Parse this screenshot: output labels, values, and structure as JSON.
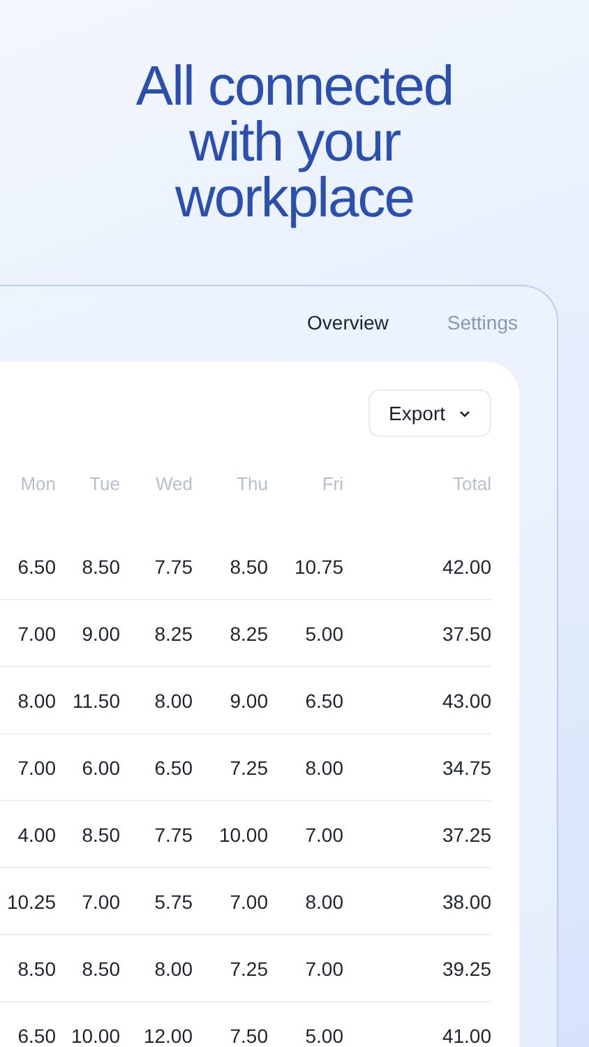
{
  "headline": "All connected with your workplace",
  "tabs": [
    {
      "label": "Overview",
      "selected": true
    },
    {
      "label": "Settings",
      "selected": false
    }
  ],
  "export_button": {
    "label": "Export"
  },
  "table": {
    "columns": [
      "Mon",
      "Tue",
      "Wed",
      "Thu",
      "Fri",
      "Total"
    ],
    "rows": [
      [
        "6.50",
        "8.50",
        "7.75",
        "8.50",
        "10.75",
        "42.00"
      ],
      [
        "7.00",
        "9.00",
        "8.25",
        "8.25",
        "5.00",
        "37.50"
      ],
      [
        "8.00",
        "11.50",
        "8.00",
        "9.00",
        "6.50",
        "43.00"
      ],
      [
        "7.00",
        "6.00",
        "6.50",
        "7.25",
        "8.00",
        "34.75"
      ],
      [
        "4.00",
        "8.50",
        "7.75",
        "10.00",
        "7.00",
        "37.25"
      ],
      [
        "10.25",
        "7.00",
        "5.75",
        "7.00",
        "8.00",
        "38.00"
      ],
      [
        "8.50",
        "8.50",
        "8.00",
        "7.25",
        "7.00",
        "39.25"
      ],
      [
        "6.50",
        "10.00",
        "12.00",
        "7.50",
        "5.00",
        "41.00"
      ]
    ]
  }
}
